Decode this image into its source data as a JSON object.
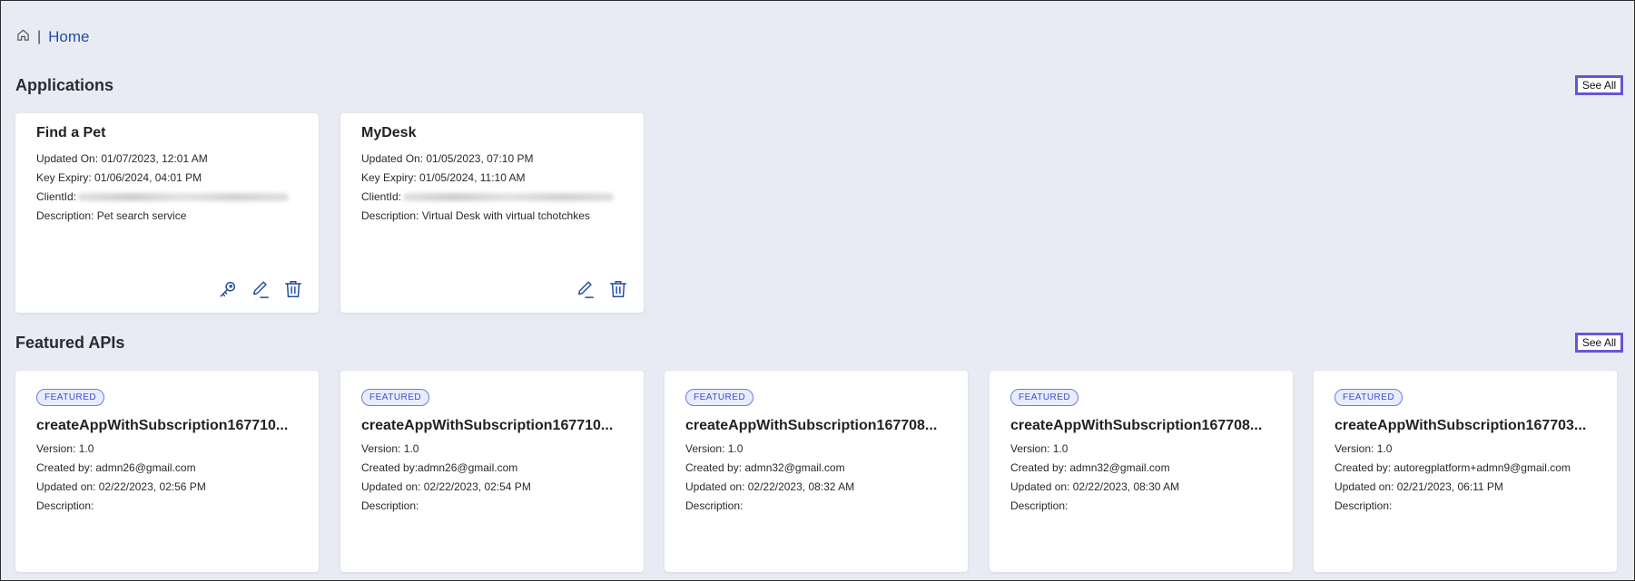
{
  "breadcrumb": {
    "separator": "|",
    "current": "Home"
  },
  "applications": {
    "title": "Applications",
    "see_all": "See All",
    "cards": [
      {
        "name": "Find a Pet",
        "updated_on": "Updated On: 01/07/2023, 12:01 AM",
        "key_expiry": "Key Expiry: 01/06/2024, 04:01 PM",
        "client_id_label": "ClientId:",
        "description": "Description: Pet search service"
      },
      {
        "name": "MyDesk",
        "updated_on": "Updated On: 01/05/2023, 07:10 PM",
        "key_expiry": "Key Expiry: 01/05/2024, 11:10 AM",
        "client_id_label": "ClientId:",
        "description": "Description: Virtual Desk with virtual tchotchkes"
      }
    ]
  },
  "featured": {
    "title": "Featured APIs",
    "see_all": "See All",
    "badge": "FEATURED",
    "cards": [
      {
        "name": "createAppWithSubscription167710...",
        "version": "Version: 1.0",
        "created_by": "Created by:  admn26@gmail.com",
        "updated_on": "Updated on: 02/22/2023, 02:56 PM",
        "description": "Description:"
      },
      {
        "name": "createAppWithSubscription167710...",
        "version": "Version: 1.0",
        "created_by": "Created by:admn26@gmail.com",
        "updated_on": "Updated on: 02/22/2023, 02:54 PM",
        "description": "Description:"
      },
      {
        "name": "createAppWithSubscription167708...",
        "version": "Version: 1.0",
        "created_by": "Created by: admn32@gmail.com",
        "updated_on": "Updated on: 02/22/2023, 08:32 AM",
        "description": "Description:"
      },
      {
        "name": "createAppWithSubscription167708...",
        "version": "Version: 1.0",
        "created_by": "Created by:  admn32@gmail.com",
        "updated_on": "Updated on: 02/22/2023, 08:30 AM",
        "description": "Description:"
      },
      {
        "name": "createAppWithSubscription167703...",
        "version": "Version: 1.0",
        "created_by": "Created by: autoregplatform+admn9@gmail.com",
        "updated_on": "Updated on: 02/21/2023, 06:11 PM",
        "description": "Description:"
      }
    ]
  },
  "icons": {
    "home": "home-icon",
    "key": "key-icon",
    "edit": "edit-icon",
    "delete": "trash-icon"
  },
  "colors": {
    "accent": "#1f4fa1",
    "see_all_border": "#6a54d6",
    "badge": "#3a4fc9",
    "background": "#e8ebf3"
  }
}
